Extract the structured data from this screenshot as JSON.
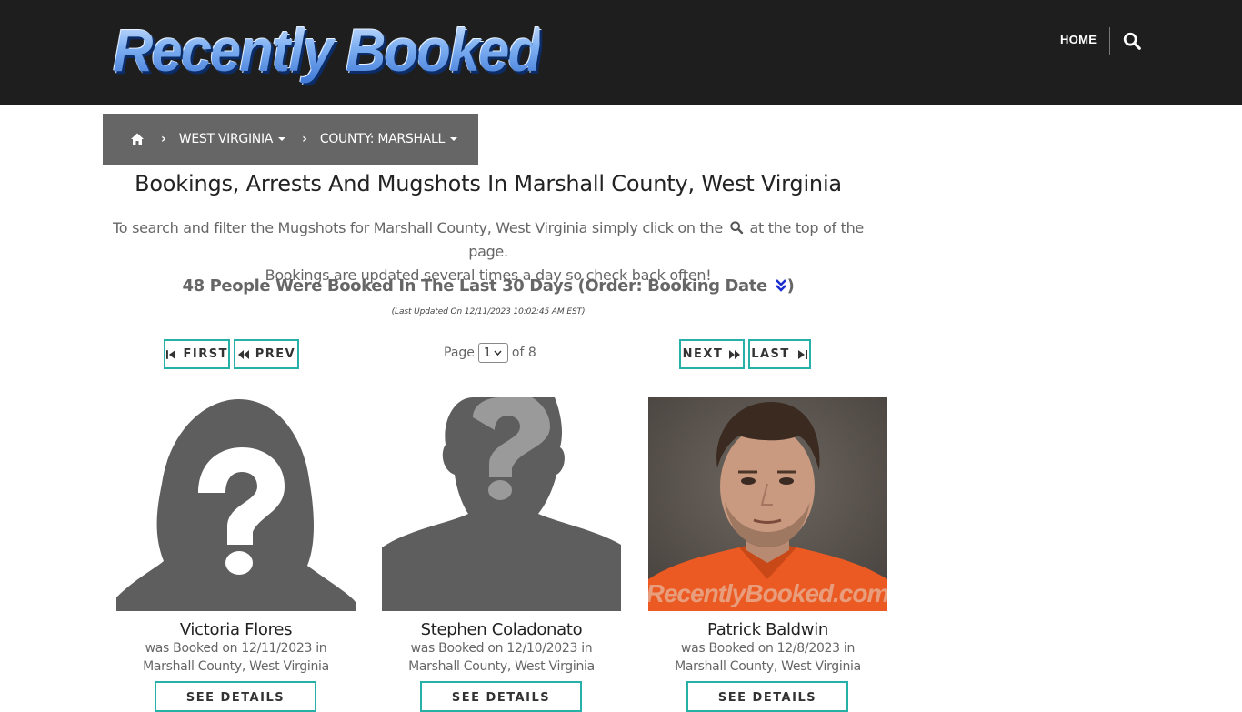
{
  "header": {
    "logo_text": "Recently Booked",
    "nav_home": "HOME",
    "search_icon": "search-icon"
  },
  "breadcrumb": {
    "home_icon": "home-icon",
    "state": "WEST VIRGINIA",
    "county": "COUNTY: MARSHALL"
  },
  "page": {
    "title": "Bookings, Arrests And Mugshots In Marshall County, West Virginia",
    "intro_part1": "To search and filter the Mugshots for Marshall County, West Virginia simply click on the",
    "intro_part2": "at the top of the page.",
    "intro_line2": "Bookings are updated several times a day so check back often!",
    "count_text": "48 People Were Booked In The Last 30 Days (Order: Booking Date",
    "count_close": ")",
    "last_updated": "(Last Updated On 12/11/2023 10:02:45 AM EST)"
  },
  "pager": {
    "first": "FIRST",
    "prev": "PREV",
    "next": "NEXT",
    "last": "LAST",
    "page_label": "Page",
    "page_value": "1",
    "of_label": "of 8"
  },
  "cards": [
    {
      "name": "Victoria Flores",
      "booked_line1": "was Booked on 12/11/2023 in",
      "booked_line2": "Marshall County, West Virginia",
      "button": "SEE DETAILS",
      "photo": "female-placeholder"
    },
    {
      "name": "Stephen Coladonato",
      "booked_line1": "was Booked on 12/10/2023 in",
      "booked_line2": "Marshall County, West Virginia",
      "button": "SEE DETAILS",
      "photo": "male-placeholder"
    },
    {
      "name": "Patrick Baldwin",
      "booked_line1": "was Booked on 12/8/2023 in",
      "booked_line2": "Marshall County, West Virginia",
      "button": "SEE DETAILS",
      "photo": "mugshot",
      "watermark": "RecentlyBooked.com"
    }
  ],
  "colors": {
    "header_bg": "#1e1e1e",
    "breadcrumb_bg": "#666666",
    "accent": "#27b0a8"
  }
}
